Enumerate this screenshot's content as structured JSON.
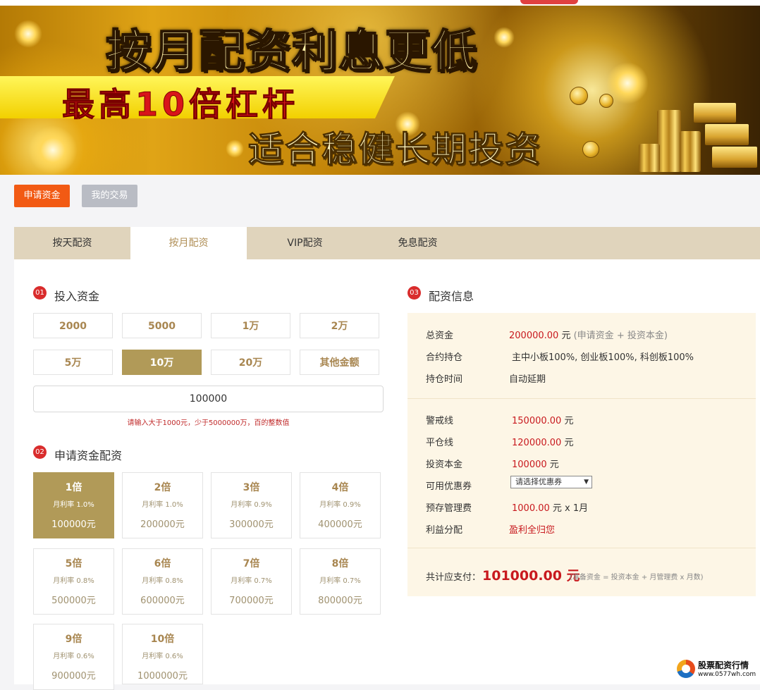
{
  "banner": {
    "headline1": "按月配资利息更低",
    "headline2": "最高10倍杠杆",
    "headline3": "适合稳健长期投资"
  },
  "actions": {
    "apply": "申请资金",
    "trades": "我的交易"
  },
  "tabs": [
    {
      "label": "按天配资",
      "active": false
    },
    {
      "label": "按月配资",
      "active": true
    },
    {
      "label": "VIP配资",
      "active": false
    },
    {
      "label": "免息配资",
      "active": false
    }
  ],
  "section1": {
    "num": "01",
    "title": "投入资金",
    "amounts": [
      "2000",
      "5000",
      "1万",
      "2万",
      "5万",
      "10万",
      "20万",
      "其他金额"
    ],
    "selected_index": 5,
    "input_value": "100000",
    "hint": "请输入大于1000元，少于5000000万，百的整数值"
  },
  "section2": {
    "num": "02",
    "title": "申请资金配资",
    "options": [
      {
        "lev": "1倍",
        "rate": "月利率 1.0%",
        "total": "100000元"
      },
      {
        "lev": "2倍",
        "rate": "月利率 1.0%",
        "total": "200000元"
      },
      {
        "lev": "3倍",
        "rate": "月利率 0.9%",
        "total": "300000元"
      },
      {
        "lev": "4倍",
        "rate": "月利率 0.9%",
        "total": "400000元"
      },
      {
        "lev": "5倍",
        "rate": "月利率 0.8%",
        "total": "500000元"
      },
      {
        "lev": "6倍",
        "rate": "月利率 0.8%",
        "total": "600000元"
      },
      {
        "lev": "7倍",
        "rate": "月利率 0.7%",
        "total": "700000元"
      },
      {
        "lev": "8倍",
        "rate": "月利率 0.7%",
        "total": "800000元"
      },
      {
        "lev": "9倍",
        "rate": "月利率 0.6%",
        "total": "900000元"
      },
      {
        "lev": "10倍",
        "rate": "月利率 0.6%",
        "total": "1000000元"
      }
    ],
    "selected_index": 0
  },
  "section3": {
    "num": "03",
    "title": "配资信息",
    "total_label": "总资金",
    "total_value": "200000.00",
    "total_unit": "元",
    "total_note": "(申请资金 + 投资本金)",
    "holding_label": "合约持仓",
    "holding_value": "主中小板100%, 创业板100%, 科创板100%",
    "period_label": "持仓时间",
    "period_value": "自动延期",
    "warning_label": "警戒线",
    "warning_value": "150000.00",
    "warning_unit": "元",
    "close_label": "平仓线",
    "close_value": "120000.00",
    "close_unit": "元",
    "principal_label": "投资本金",
    "principal_value": "100000",
    "principal_unit": "元",
    "coupon_label": "可用优惠券",
    "coupon_value": "请选择优惠券",
    "fee_label": "预存管理费",
    "fee_value": "1000.00",
    "fee_unit": "元 x 1月",
    "profit_label": "利益分配",
    "profit_value": "盈利全归您",
    "pay_label": "共计应支付：",
    "pay_value": "101000.00 元",
    "pay_note": "(准备资金 = 投资本金 + 月管理费 x 月数)"
  },
  "watermark": {
    "title": "股票配资行情",
    "url": "www.0577wh.com"
  },
  "colors": {
    "accent_orange": "#f25a14",
    "gold": "#b19a58",
    "tab_bg": "#e0d4bc",
    "red": "#c8191e",
    "info_bg": "#fdf6e6"
  }
}
